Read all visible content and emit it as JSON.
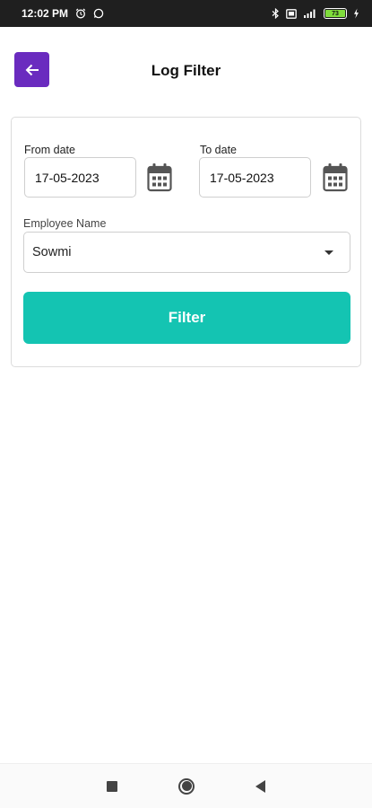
{
  "status_bar": {
    "time": "12:02 PM",
    "battery_level": "73"
  },
  "header": {
    "title": "Log Filter"
  },
  "form": {
    "from_date": {
      "label": "From date",
      "value": "17-05-2023"
    },
    "to_date": {
      "label": "To date",
      "value": "17-05-2023"
    },
    "employee": {
      "label": "Employee Name",
      "value": "Sowmi"
    },
    "filter_label": "Filter"
  },
  "colors": {
    "accent": "#6a2bbf",
    "button": "#14c4b2",
    "status_bar": "#1f1f1f"
  }
}
